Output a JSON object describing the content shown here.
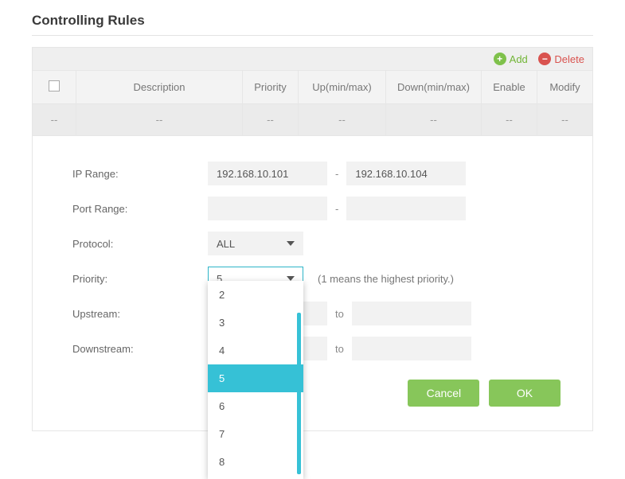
{
  "heading": "Controlling Rules",
  "toolbar": {
    "add_label": "Add",
    "delete_label": "Delete"
  },
  "table": {
    "columns": [
      "",
      "Description",
      "Priority",
      "Up(min/max)",
      "Down(min/max)",
      "Enable",
      "Modify"
    ],
    "empty_row": [
      "--",
      "--",
      "--",
      "--",
      "--",
      "--",
      "--"
    ]
  },
  "form": {
    "ip_range_label": "IP Range:",
    "ip_start": "192.168.10.101",
    "ip_end": "192.168.10.104",
    "port_range_label": "Port Range:",
    "port_start": "",
    "port_end": "",
    "protocol_label": "Protocol:",
    "protocol_value": "ALL",
    "priority_label": "Priority:",
    "priority_value": "5",
    "priority_hint": "(1 means the highest priority.)",
    "upstream_label": "Upstream:",
    "downstream_label": "Downstream:",
    "to_label": "to",
    "cancel": "Cancel",
    "ok": "OK"
  },
  "dropdown": {
    "options": [
      "2",
      "3",
      "4",
      "5",
      "6",
      "7",
      "8"
    ],
    "selected": "5"
  }
}
